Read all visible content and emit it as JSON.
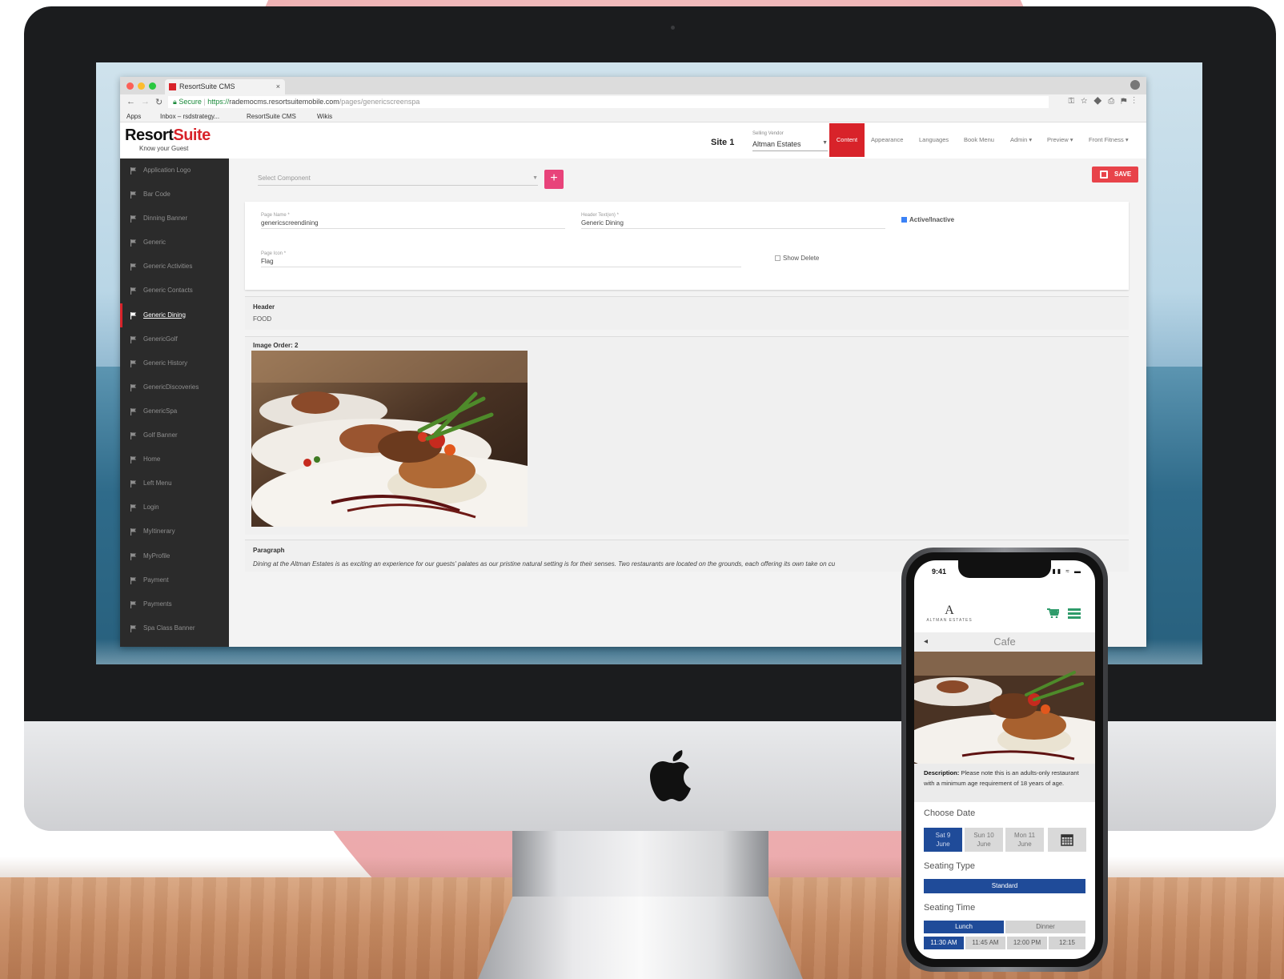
{
  "browser": {
    "tab_title": "ResortSuite CMS",
    "tab_close": "×",
    "url_secure": "Secure",
    "url_scheme": "https://",
    "url_host": "rademocms.resortsuitemobile.com",
    "url_path": "/pages/genericscreenspa",
    "bookmarks": [
      "Apps",
      "Inbox – rsdstrategy...",
      "ResortSuite CMS",
      "Wikis"
    ]
  },
  "app": {
    "logo_black": "Resort",
    "logo_red": "Suite",
    "tagline": "Know your Guest",
    "site_label": "Site 1",
    "vendor_label": "Selling Vendor",
    "vendor_value": "Altman Estates",
    "nav_tabs": [
      "Content",
      "Appearance",
      "Languages",
      "Book Menu",
      "Admin ▾",
      "Preview ▾",
      "Front Fitness ▾"
    ],
    "active_tab": "Content",
    "save_label": "SAVE"
  },
  "sidebar": {
    "items": [
      "Application Logo",
      "Bar Code",
      "Dinning Banner",
      "Generic",
      "Generic Activities",
      "Generic Contacts",
      "Generic Dining",
      "GenericGolf",
      "Generic History",
      "GenericDiscoveries",
      "GenericSpa",
      "Golf Banner",
      "Home",
      "Left Menu",
      "Login",
      "MyItinerary",
      "MyProfile",
      "Payment",
      "Payments",
      "Spa Class Banner"
    ],
    "active_index": 6
  },
  "main": {
    "component_placeholder": "Select Component",
    "plus_label": "+",
    "page_name_label": "Page Name *",
    "page_name_value": "genericscreendining",
    "header_text_label": "Header Text(en) *",
    "header_text_value": "Generic Dining",
    "active_label": "Active/Inactive",
    "page_icon_label": "Page Icon *",
    "page_icon_value": "Flag",
    "show_delete_label": "Show Delete",
    "header_section_label": "Header",
    "header_section_value": "FOOD",
    "image_section_label": "Image   Order: 2",
    "paragraph_label": "Paragraph",
    "paragraph_text": "Dining at the Altman Estates is as exciting an experience for our guests' palates as our pristine natural setting is for their senses. Two restaurants are located on the grounds, each offering its own take on cu"
  },
  "phone": {
    "time": "9:41",
    "status": "▮▮ ≈ ▬",
    "brand_letter": "A",
    "brand_name": "ALTMAN ESTATES",
    "page_title": "Cafe",
    "back": "◂",
    "desc_bold": "Description:",
    "desc_text": " Please note this is an adults-only restaurant with a minimum age requirement of 18 years of age.",
    "choose_date": "Choose Date",
    "dates": [
      {
        "line1": "Sat 9",
        "line2": "June"
      },
      {
        "line1": "Sun 10",
        "line2": "June"
      },
      {
        "line1": "Mon 11",
        "line2": "June"
      }
    ],
    "seating_type": "Seating Type",
    "standard": "Standard",
    "seating_time": "Seating Time",
    "lunch": "Lunch",
    "dinner": "Dinner",
    "times": [
      "11:30 AM",
      "11:45 AM",
      "12:00 PM",
      "12:15"
    ]
  },
  "colors": {
    "brand_red": "#d8232a",
    "accent_pink": "#e8437a",
    "phone_blue": "#1f4b99",
    "phone_green": "#2e9b6a"
  }
}
